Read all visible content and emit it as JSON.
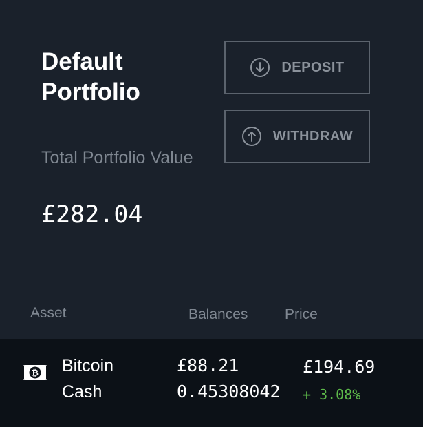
{
  "portfolio": {
    "title": "Default Portfolio",
    "total_label": "Total Portfolio Value",
    "total_value": "£282.04"
  },
  "actions": {
    "deposit_label": "DEPOSIT",
    "deposit_icon": "arrow-down-circle-icon",
    "withdraw_label": "WITHDRAW",
    "withdraw_icon": "arrow-up-circle-icon"
  },
  "table": {
    "headers": {
      "asset": "Asset",
      "balances": "Balances",
      "price": "Price"
    },
    "rows": [
      {
        "icon": "bitcoin-cash-icon",
        "name": "Bitcoin Cash",
        "balance_fiat": "£88.21",
        "balance_crypto": "0.45308042",
        "price": "£194.69",
        "change": "+ 3.08%"
      }
    ]
  },
  "colors": {
    "background": "#1a212b",
    "row_background": "#0c1117",
    "positive_change": "#5db84a",
    "muted_text": "#7f8791"
  }
}
